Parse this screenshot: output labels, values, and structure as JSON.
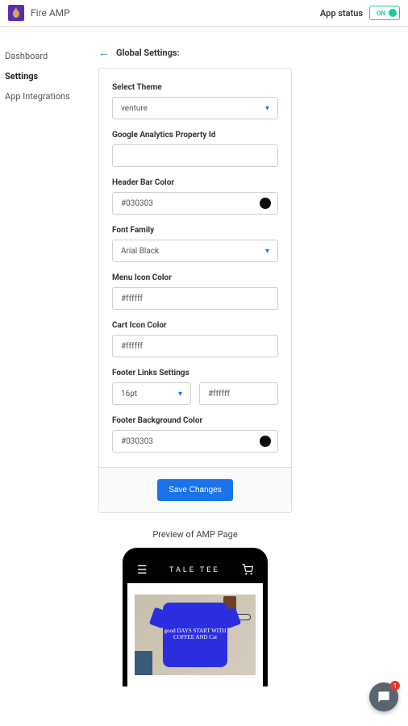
{
  "header": {
    "app_name": "Fire AMP",
    "status_label": "App status",
    "status_value": "ON"
  },
  "sidebar": {
    "items": [
      {
        "label": "Dashboard"
      },
      {
        "label": "Settings"
      },
      {
        "label": "App Integrations"
      }
    ],
    "active_index": 1
  },
  "page": {
    "back_title": "Global Settings:"
  },
  "form": {
    "theme": {
      "label": "Select Theme",
      "value": "venture"
    },
    "ga": {
      "label": "Google Analytics Property Id",
      "value": ""
    },
    "header_color": {
      "label": "Header Bar Color",
      "value": "#030303",
      "swatch": "#0d0d0d"
    },
    "font_family": {
      "label": "Font Family",
      "value": "Arial Black"
    },
    "menu_icon_color": {
      "label": "Menu Icon Color",
      "value": "#ffffff"
    },
    "cart_icon_color": {
      "label": "Cart Icon Color",
      "value": "#ffffff"
    },
    "footer_links": {
      "label": "Footer Links Settings",
      "size": "16pt",
      "color": "#ffffff"
    },
    "footer_bg": {
      "label": "Footer Background Color",
      "value": "#030303",
      "swatch": "#0d0d0d"
    },
    "save_label": "Save Changes"
  },
  "preview": {
    "title": "Preview of AMP Page",
    "store_name": "TALE TEE",
    "shirt_text": "good DAYS START WITH COFFEE AND Cat"
  },
  "chat": {
    "badge_count": "1"
  }
}
